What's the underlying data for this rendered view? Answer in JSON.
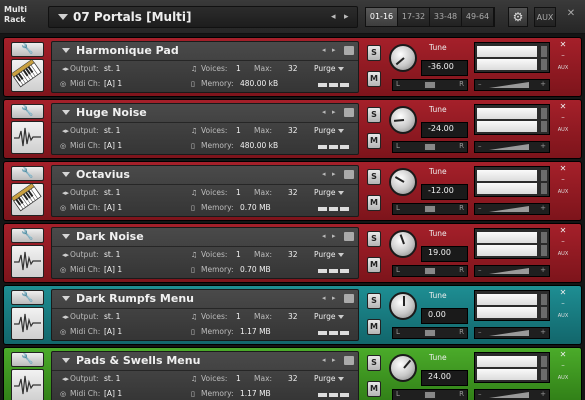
{
  "app": {
    "rack_label": "Multi Rack",
    "multi_name": "07 Portals [Multi]",
    "prev_arrow": "◂",
    "next_arrow": "▸"
  },
  "tabs": [
    {
      "label": "01-16",
      "active": true
    },
    {
      "label": "17-32",
      "active": false
    },
    {
      "label": "33-48",
      "active": false
    },
    {
      "label": "49-64",
      "active": false
    }
  ],
  "top_aux": "AUX",
  "top_close": "✕",
  "labels": {
    "output": "Output:",
    "midi": "Midi Ch:",
    "voices": "Voices:",
    "max": "Max:",
    "memory": "Memory:",
    "purge": "Purge",
    "tune": "Tune",
    "s": "S",
    "m": "M",
    "aux": "AUX",
    "close": "✕",
    "minimize": "–",
    "pan_l": "L",
    "pan_r": "R",
    "vol_minus": "–",
    "vol_plus": "+"
  },
  "instruments": [
    {
      "name": "Harmonique Pad",
      "color": "red",
      "thumb": "keyboard",
      "output": "st. 1",
      "midi": "[A]  1",
      "voices": "1",
      "max": "32",
      "memory": "480.00 kB",
      "tune": "-36.00"
    },
    {
      "name": "Huge Noise",
      "color": "red",
      "thumb": "waveform",
      "output": "st. 1",
      "midi": "[A]  1",
      "voices": "1",
      "max": "32",
      "memory": "480.00 kB",
      "tune": "-24.00"
    },
    {
      "name": "Octavius",
      "color": "red",
      "thumb": "keyboard",
      "output": "st. 1",
      "midi": "[A]  1",
      "voices": "1",
      "max": "32",
      "memory": "0.70 MB",
      "tune": "-12.00"
    },
    {
      "name": "Dark Noise",
      "color": "red",
      "thumb": "waveform",
      "output": "st. 1",
      "midi": "[A]  1",
      "voices": "1",
      "max": "32",
      "memory": "0.70 MB",
      "tune": "19.00"
    },
    {
      "name": "Dark Rumpfs Menu",
      "color": "teal",
      "thumb": "waveform",
      "output": "st. 1",
      "midi": "[A]  1",
      "voices": "1",
      "max": "32",
      "memory": "1.17 MB",
      "tune": "0.00"
    },
    {
      "name": "Pads & Swells Menu",
      "color": "green",
      "thumb": "waveform",
      "output": "st. 1",
      "midi": "[A]  1",
      "voices": "1",
      "max": "32",
      "memory": "1.17 MB",
      "tune": "24.00"
    }
  ]
}
